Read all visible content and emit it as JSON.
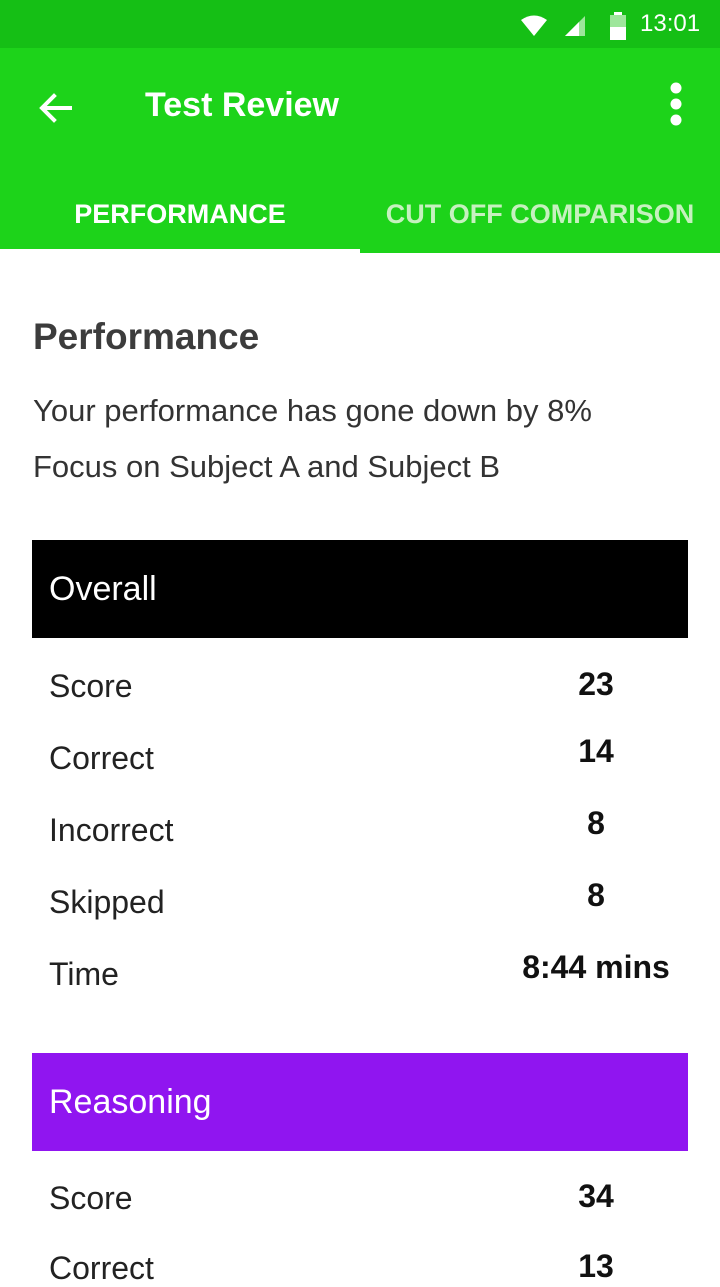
{
  "status_bar": {
    "time": "13:01",
    "colors": {
      "background": "#15bf15"
    }
  },
  "app_bar": {
    "title": "Test Review",
    "back_icon": "arrow-left-icon",
    "menu_icon": "more-vertical-icon",
    "color": "#1dd31a"
  },
  "tabs": [
    {
      "label": "PERFORMANCE",
      "active": true
    },
    {
      "label": "CUT OFF COMPARISON",
      "active": false
    }
  ],
  "performance": {
    "heading": "Performance",
    "line1": "Your performance has gone down by 8%",
    "line2": "Focus on Subject A and Subject B"
  },
  "sections": [
    {
      "title": "Overall",
      "color": "#000000",
      "rows": [
        {
          "label": "Score",
          "value": "23"
        },
        {
          "label": "Correct",
          "value": "14"
        },
        {
          "label": "Incorrect",
          "value": "8"
        },
        {
          "label": "Skipped",
          "value": "8"
        },
        {
          "label": "Time",
          "value": "8:44 mins"
        }
      ]
    },
    {
      "title": "Reasoning",
      "color": "#9015f0",
      "rows": [
        {
          "label": "Score",
          "value": "34"
        },
        {
          "label": "Correct",
          "value": "13"
        }
      ]
    }
  ]
}
